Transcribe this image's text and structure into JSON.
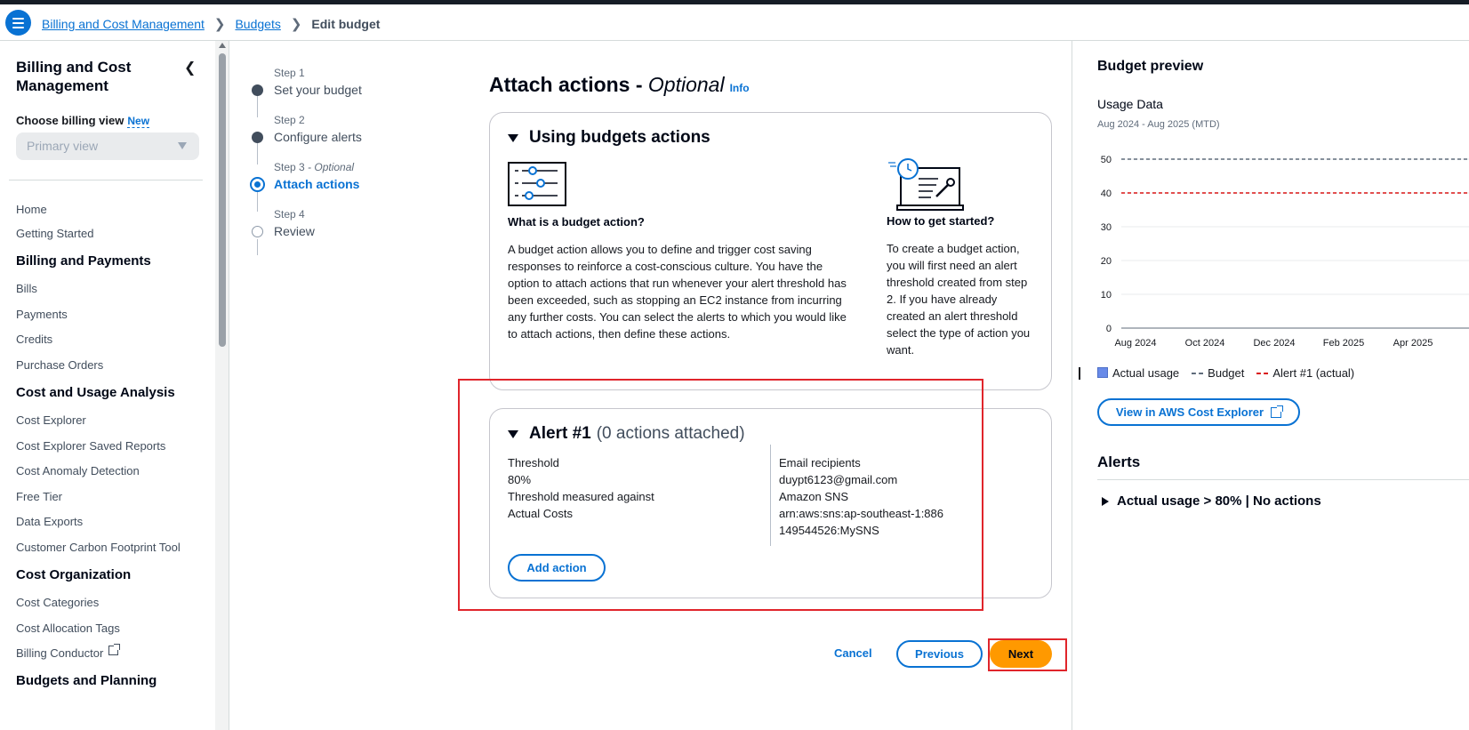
{
  "breadcrumb": {
    "items": [
      "Billing and Cost Management",
      "Budgets"
    ],
    "current": "Edit budget"
  },
  "sidebar": {
    "title": "Billing and Cost Management",
    "choose_label": "Choose billing view",
    "new_badge": "New",
    "select_value": "Primary view",
    "home": "Home",
    "getting_started": "Getting Started",
    "sections": [
      {
        "heading": "Billing and Payments",
        "items": [
          "Bills",
          "Payments",
          "Credits",
          "Purchase Orders"
        ]
      },
      {
        "heading": "Cost and Usage Analysis",
        "items": [
          "Cost Explorer",
          "Cost Explorer Saved Reports",
          "Cost Anomaly Detection",
          "Free Tier",
          "Data Exports",
          "Customer Carbon Footprint Tool"
        ]
      },
      {
        "heading": "Cost Organization",
        "items": [
          "Cost Categories",
          "Cost Allocation Tags",
          "Billing Conductor"
        ]
      },
      {
        "heading": "Budgets and Planning",
        "items": []
      }
    ]
  },
  "steps": [
    {
      "label": "Step 1",
      "optional": "",
      "name": "Set your budget"
    },
    {
      "label": "Step 2",
      "optional": "",
      "name": "Configure alerts"
    },
    {
      "label": "Step 3",
      "optional": " - Optional",
      "name": "Attach actions"
    },
    {
      "label": "Step 4",
      "optional": "",
      "name": "Review"
    }
  ],
  "main": {
    "title": "Attach actions - ",
    "title_optional": "Optional",
    "info": "Info",
    "using": {
      "heading": "Using budgets actions",
      "what_heading": "What is a budget action?",
      "what_text": "A budget action allows you to define and trigger cost saving responses to reinforce a cost-conscious culture. You have the option to attach actions that run whenever your alert threshold has been exceeded, such as stopping an EC2 instance from incurring any further costs. You can select the alerts to which you would like to attach actions, then define these actions.",
      "how_heading": "How to get started?",
      "how_text": "To create a budget action, you will first need an alert threshold created from step 2. If you have already created an alert threshold select the type of action you want."
    },
    "alert": {
      "title": "Alert #1",
      "count": "(0 actions attached)",
      "threshold_label": "Threshold",
      "threshold_value": "80%",
      "measured_label": "Threshold measured against",
      "measured_value": "Actual Costs",
      "email_label": "Email recipients",
      "email_value": "duypt6123@gmail.com",
      "sns_label": "Amazon SNS",
      "sns_value": "arn:aws:sns:ap-southeast-1:886149544526:MySNS",
      "add_action": "Add action"
    },
    "footer": {
      "cancel": "Cancel",
      "previous": "Previous",
      "next": "Next"
    }
  },
  "preview": {
    "title": "Budget preview",
    "subtitle": "Usage Data",
    "date_range": "Aug 2024 - Aug 2025 (MTD)",
    "legend": [
      "Actual usage",
      "Budget",
      "Alert #1 (actual)"
    ],
    "cost_explorer_btn": "View in AWS Cost Explorer",
    "alerts_heading": "Alerts",
    "alert_item": "Actual usage > 80% | No actions"
  },
  "chart_data": {
    "type": "line",
    "x": [
      "Aug 2024",
      "Oct 2024",
      "Dec 2024",
      "Feb 2025",
      "Apr 2025"
    ],
    "ylim": [
      0,
      50
    ],
    "yticks": [
      0,
      10,
      20,
      30,
      40,
      50
    ],
    "series": [
      {
        "name": "Budget",
        "values": [
          50,
          50,
          50,
          50,
          50
        ],
        "color": "#5f6b7a",
        "style": "dashed"
      },
      {
        "name": "Alert #1 (actual)",
        "values": [
          40,
          40,
          40,
          40,
          40
        ],
        "color": "#d91515",
        "style": "dashed"
      },
      {
        "name": "Actual usage",
        "values": [
          0,
          0,
          0,
          0,
          0
        ],
        "color": "#688ae8",
        "style": "bar"
      }
    ],
    "grid": true
  },
  "colors": {
    "accent": "#0972d3",
    "primary_button": "#ff9900",
    "highlight": "#e0252b"
  }
}
